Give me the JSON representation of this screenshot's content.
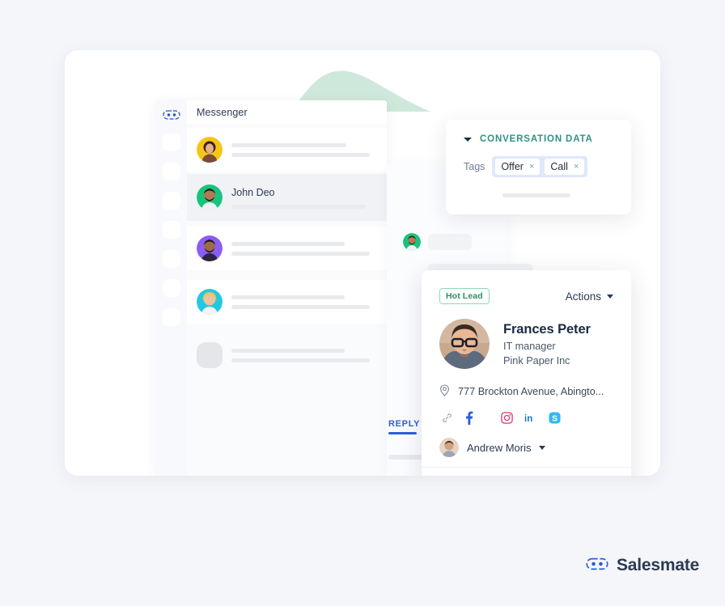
{
  "background_color": "#f4f6fa",
  "messenger": {
    "header_title": "Messenger",
    "rail_logo_name": "salesmate-logo-icon",
    "rail_items": 7,
    "conversations": [
      {
        "name": "",
        "avatar": "woman-yellow-avatar",
        "state": "read"
      },
      {
        "name": "John Deo",
        "avatar": "man-green-avatar",
        "state": "active"
      },
      {
        "name": "",
        "avatar": "man-purple-avatar",
        "state": "read"
      },
      {
        "name": "",
        "avatar": "woman-cyan-avatar",
        "state": "read"
      },
      {
        "name": "",
        "avatar": "placeholder-gray-avatar",
        "state": "read"
      }
    ],
    "reply_tab_label": "REPLY",
    "thread_avatar": "man-green-avatar"
  },
  "conversation_panel": {
    "title": "CONVERSATION DATA",
    "title_color": "#2f9284",
    "collapse_icon": "chevron-down-icon",
    "tags_label": "Tags",
    "tags": [
      {
        "label": "Offer",
        "remove": "×"
      },
      {
        "label": "Call",
        "remove": "×"
      }
    ]
  },
  "contact_card": {
    "badge": "Hot Lead",
    "badge_color": "#2f8f5e",
    "actions_label": "Actions",
    "avatar_name": "frances-peter-avatar",
    "name": "Frances Peter",
    "role": "IT manager",
    "company": "Pink Paper Inc",
    "address": "777 Brockton Avenue, Abingto...",
    "address_icon": "location-pin-icon",
    "socials": [
      {
        "name": "link-icon",
        "label": "Link",
        "color": "#8b97a8"
      },
      {
        "name": "facebook-icon",
        "label": "Facebook",
        "color": "#2b5fd9"
      },
      {
        "name": "instagram-icon",
        "label": "Instagram",
        "color": "#e5407c"
      },
      {
        "name": "linkedin-icon",
        "label": "LinkedIn",
        "color": "#1f76bc"
      },
      {
        "name": "skype-icon",
        "label": "Skype",
        "color": "#35b6f0"
      }
    ],
    "owner_name": "Andrew Moris",
    "owner_avatar": "andrew-moris-avatar",
    "action_buttons": [
      {
        "name": "call-button",
        "icon": "phone-icon"
      },
      {
        "name": "sms-button",
        "icon": "mobile-message-icon"
      },
      {
        "name": "email-button",
        "icon": "envelope-icon"
      },
      {
        "name": "email-thread-button",
        "icon": "envelope-stack-icon"
      }
    ],
    "action_button_color": "#2c3e5d"
  },
  "brand": {
    "name": "Salesmate",
    "logo_icon": "salesmate-logo-icon",
    "logo_color": "#2b5fd9"
  }
}
